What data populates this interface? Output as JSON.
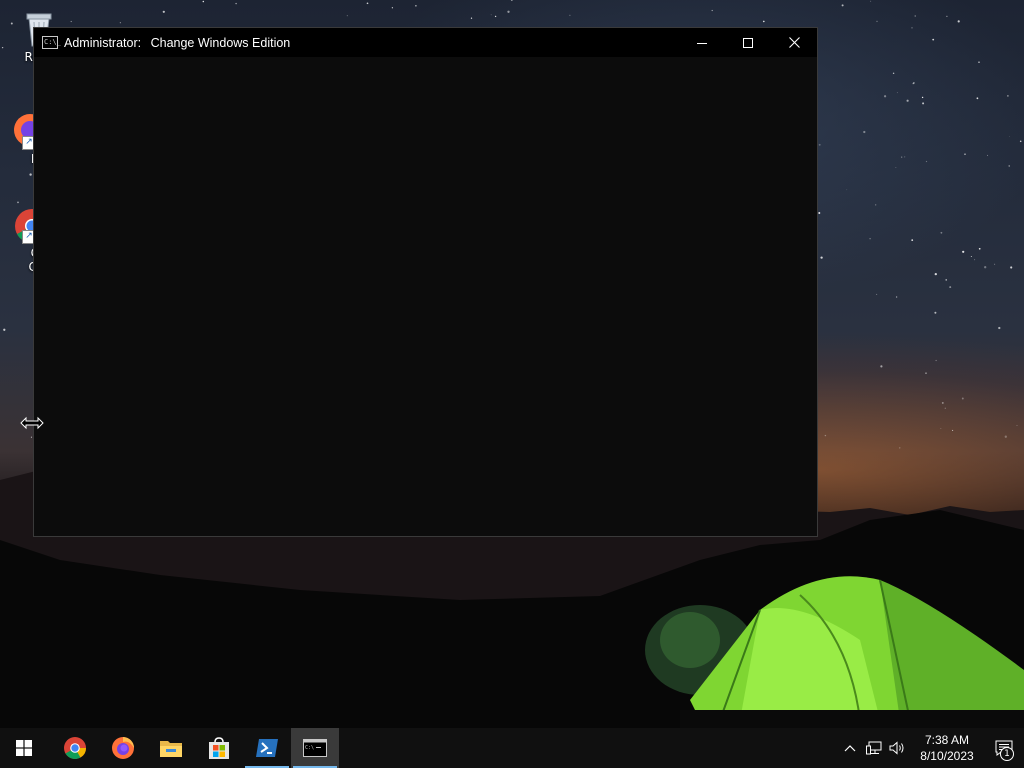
{
  "desktop": {
    "icons": [
      {
        "label": "Recy",
        "icon": "recycle-bin-icon"
      },
      {
        "label": "Fir",
        "icon": "firefox-icon"
      },
      {
        "label": "Go Chr",
        "label_line1": "Go",
        "label_line2": "Chr",
        "icon": "chrome-icon"
      }
    ]
  },
  "window": {
    "title_prefix": "Administrator: ",
    "title": "Change Windows Edition",
    "icon": "cmd-console-icon",
    "controls": [
      "minimize",
      "maximize",
      "close"
    ]
  },
  "taskbar": {
    "buttons": [
      {
        "name": "start",
        "icon": "windows-start-icon"
      },
      {
        "name": "chrome",
        "icon": "chrome-icon"
      },
      {
        "name": "firefox",
        "icon": "firefox-icon"
      },
      {
        "name": "file-explorer",
        "icon": "folder-icon"
      },
      {
        "name": "microsoft-store",
        "icon": "store-icon"
      },
      {
        "name": "powershell",
        "icon": "powershell-icon",
        "open": true
      },
      {
        "name": "command-prompt",
        "icon": "cmd-console-icon",
        "open": true,
        "active": true
      }
    ],
    "tray": {
      "time": "7:38 AM",
      "date": "8/10/2023",
      "notification_count": "1"
    }
  },
  "colors": {
    "console_bg": "#0c0c0c",
    "titlebar_bg": "#000000",
    "taskbar_bg": "#101010",
    "accent": "#76b9ed",
    "tent_green": "#8ee63a"
  }
}
